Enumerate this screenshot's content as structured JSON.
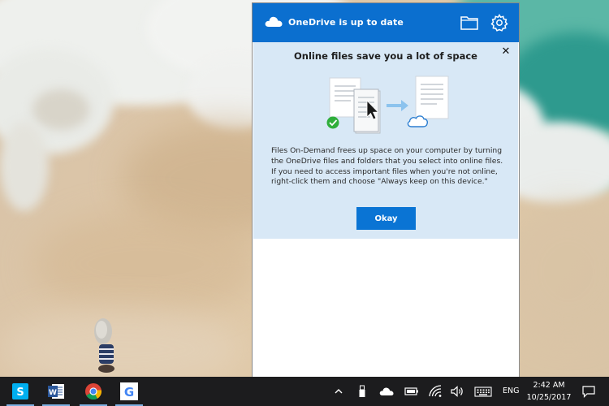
{
  "onedrive": {
    "status": "OneDrive is up to date",
    "icons": {
      "cloud": "onedrive-cloud-icon",
      "folder": "folder-icon",
      "settings": "gear-icon",
      "close": "close-icon"
    },
    "promo": {
      "close_glyph": "✕",
      "title": "Online files save you a lot of space",
      "body": "Files On-Demand frees up space on your computer by turning the OneDrive files and folders that you select into online files. If you need to access important files when you're not online, right-click them and choose \"Always keep on this device.\"",
      "okay_label": "Okay"
    }
  },
  "taskbar": {
    "apps": [
      {
        "name": "Skype",
        "icon": "skype-icon",
        "color": "#00aff0"
      },
      {
        "name": "Word",
        "icon": "word-icon",
        "color": "#2b579a"
      },
      {
        "name": "Chrome",
        "icon": "chrome-icon",
        "color": "#db4437"
      },
      {
        "name": "Google",
        "icon": "google-icon",
        "color": "#4285f4"
      }
    ],
    "tray": {
      "icons": [
        "chevron-up-icon",
        "usb-icon",
        "onedrive-cloud-icon",
        "battery-icon",
        "wifi-icon",
        "volume-icon",
        "keyboard-icon"
      ],
      "language": "ENG",
      "time": "2:42 AM",
      "date": "10/25/2017",
      "action_center": "notification-icon"
    }
  },
  "colors": {
    "onedrive_header": "#0b6fcf",
    "promo_background": "#d8e8f6",
    "okay_button": "#0a74d4",
    "taskbar": "#1c1c1e"
  }
}
